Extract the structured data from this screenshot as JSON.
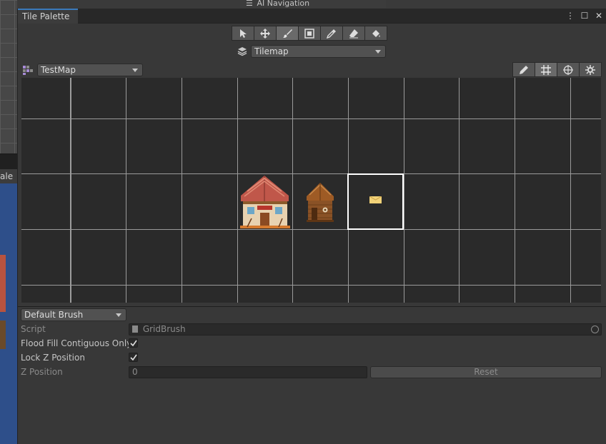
{
  "background": {
    "left_tab_label": "ale",
    "ai_tab_label": "AI Navigation"
  },
  "window": {
    "title": "Tile Palette",
    "controls": [
      "⋮",
      "☐",
      "✕"
    ]
  },
  "tools": [
    {
      "name": "select-tool",
      "icon": "arrow-cursor-icon"
    },
    {
      "name": "move-tool",
      "icon": "move-arrows-icon"
    },
    {
      "name": "paint-tool",
      "icon": "paintbrush-icon",
      "active": true
    },
    {
      "name": "box-fill-tool",
      "icon": "box-select-icon"
    },
    {
      "name": "picker-tool",
      "icon": "eyedropper-icon"
    },
    {
      "name": "erase-tool",
      "icon": "eraser-icon"
    },
    {
      "name": "fill-tool",
      "icon": "paint-bucket-icon"
    }
  ],
  "active_tilemap": {
    "value": "Tilemap"
  },
  "palette": {
    "value": "TestMap",
    "tools": [
      {
        "name": "edit-palette",
        "icon": "pencil-icon"
      },
      {
        "name": "toggle-grid",
        "icon": "grid-icon",
        "active": true
      },
      {
        "name": "toggle-gizmos",
        "icon": "gizmo-icon"
      },
      {
        "name": "palette-settings",
        "icon": "settings-icon"
      }
    ]
  },
  "brush": {
    "selected": "Default Brush",
    "script_label": "Script",
    "script_value": "GridBrush",
    "flood_fill_label": "Flood Fill Contiguous Only",
    "flood_fill_checked": true,
    "lock_z_label": "Lock Z Position",
    "lock_z_checked": true,
    "z_position_label": "Z Position",
    "z_position_value": "0",
    "reset_label": "Reset"
  },
  "colors": {
    "accent": "#3a79bb",
    "grid_line": "#a0a0a0",
    "selection": "#ffffff"
  }
}
